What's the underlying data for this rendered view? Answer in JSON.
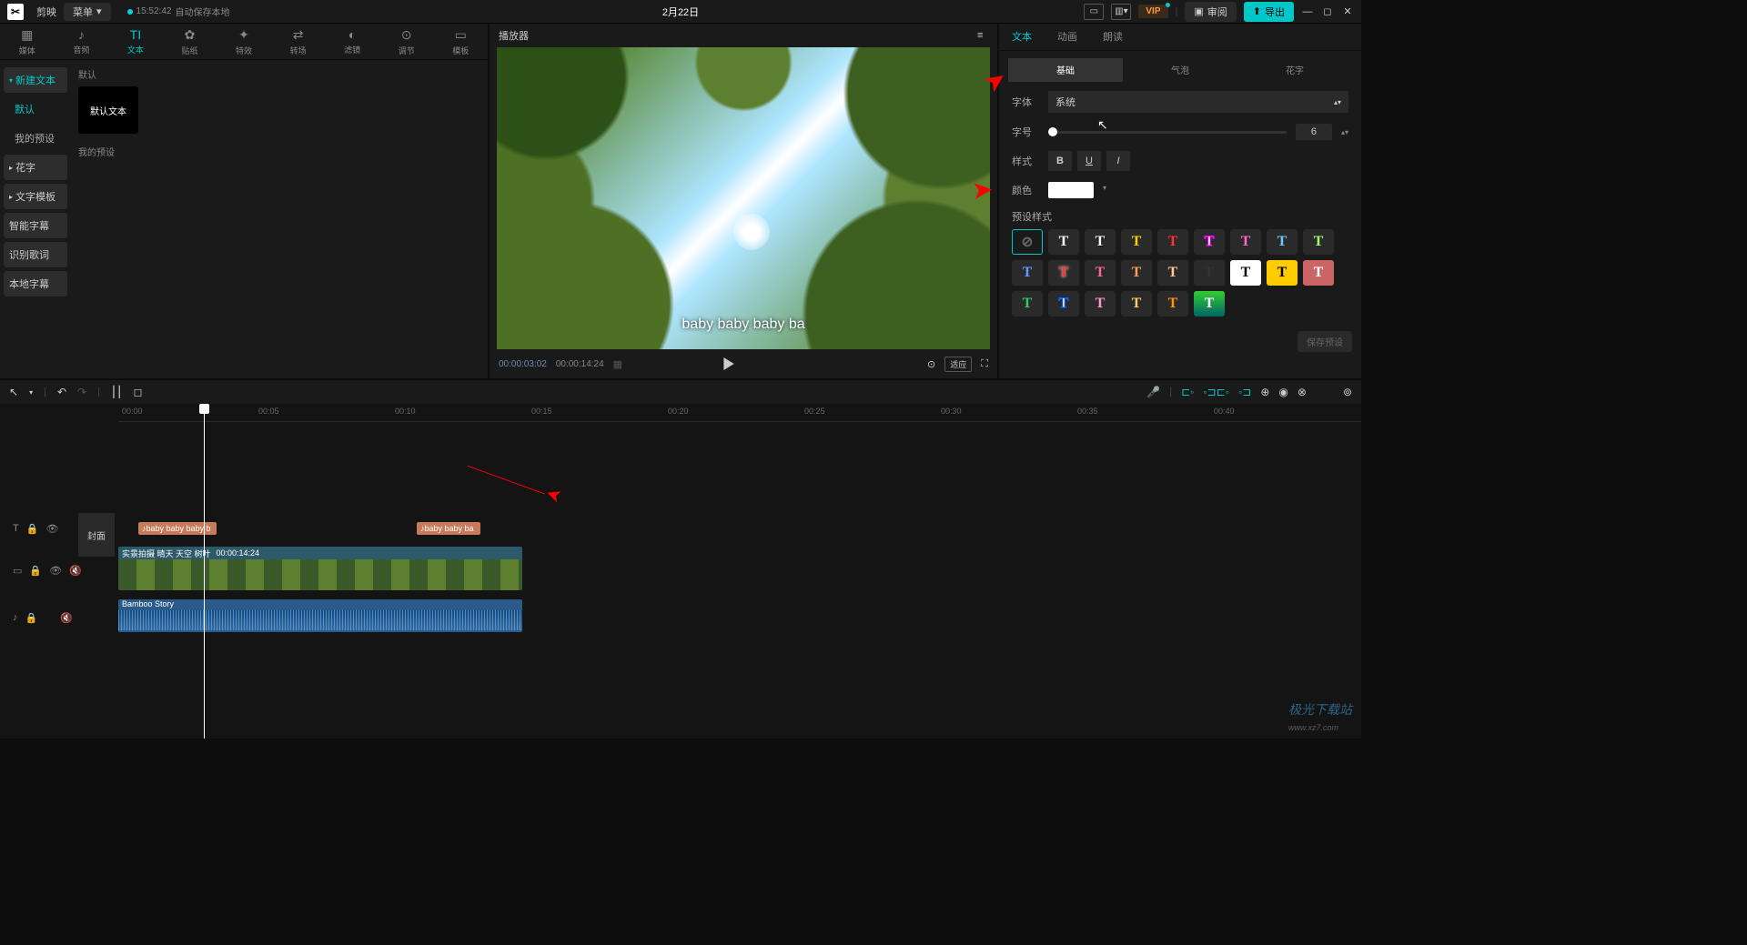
{
  "titlebar": {
    "app": "剪映",
    "menu": "菜单",
    "autosave_time": "15:52:42",
    "autosave_text": "自动保存本地",
    "project": "2月22日",
    "vip": "VIP",
    "review": "审阅",
    "export": "导出"
  },
  "top_tabs": [
    {
      "icon": "▦",
      "label": "媒体"
    },
    {
      "icon": "♪",
      "label": "音频"
    },
    {
      "icon": "TI",
      "label": "文本"
    },
    {
      "icon": "✿",
      "label": "贴纸"
    },
    {
      "icon": "✦",
      "label": "特效"
    },
    {
      "icon": "⇄",
      "label": "转场"
    },
    {
      "icon": "◐",
      "label": "滤镜"
    },
    {
      "icon": "⊙",
      "label": "调节"
    },
    {
      "icon": "▭",
      "label": "模板"
    }
  ],
  "sidebar": {
    "new_text": "新建文本",
    "default": "默认",
    "my_preset": "我的预设",
    "huazi": "花字",
    "text_template": "文字模板",
    "smart_sub": "智能字幕",
    "lyrics": "识别歌词",
    "local_sub": "本地字幕"
  },
  "content": {
    "default_label": "默认",
    "default_text": "默认文本",
    "my_preset_label": "我的预设"
  },
  "player": {
    "title": "播放器",
    "overlay": "baby baby baby ba",
    "current": "00:00:03:02",
    "total": "00:00:14:24",
    "ratio": "适应"
  },
  "right": {
    "tabs": [
      "文本",
      "动画",
      "朗读"
    ],
    "subtabs": [
      "基础",
      "气泡",
      "花字"
    ],
    "font_label": "字体",
    "font_value": "系统",
    "size_label": "字号",
    "size_value": "6",
    "style_label": "样式",
    "color_label": "颜色",
    "preset_label": "预设样式",
    "save_preset": "保存预设"
  },
  "timeline": {
    "marks": [
      "00:00",
      "00:05",
      "00:10",
      "00:15",
      "00:20",
      "00:25",
      "00:30",
      "00:35",
      "00:40"
    ],
    "cover": "封面",
    "text_clip1": "baby baby baby b",
    "text_clip2": "baby baby ba",
    "video_name": "实景拍摄 晴天 天空 树叶",
    "video_dur": "00:00:14:24",
    "audio_name": "Bamboo Story"
  },
  "watermark": {
    "main": "极光下载站",
    "sub": "www.xz7.com"
  }
}
